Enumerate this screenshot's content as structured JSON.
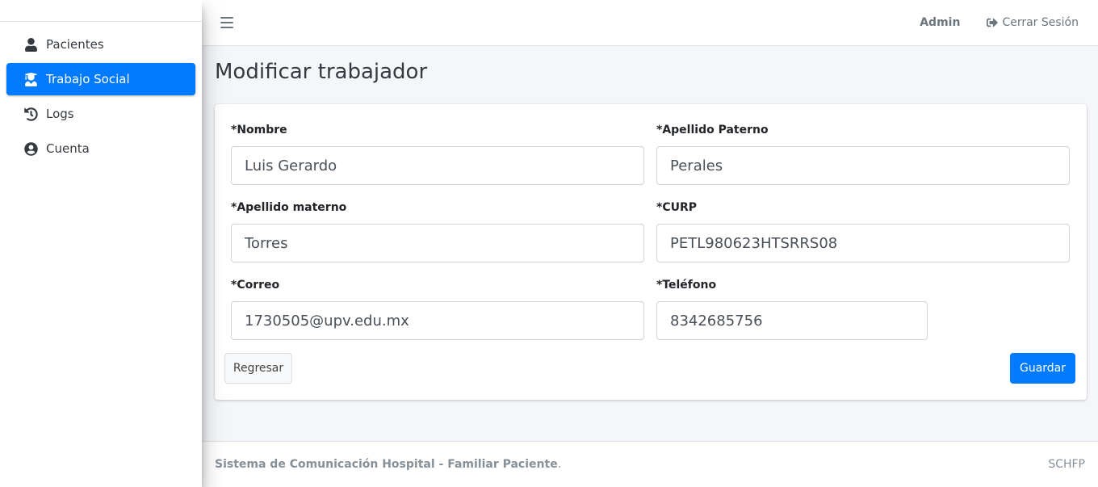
{
  "sidebar": {
    "items": [
      {
        "label": "Pacientes",
        "icon": "user-icon",
        "active": false
      },
      {
        "label": "Trabajo Social",
        "icon": "user-nurse-icon",
        "active": true
      },
      {
        "label": "Logs",
        "icon": "history-icon",
        "active": false
      },
      {
        "label": "Cuenta",
        "icon": "user-circle-icon",
        "active": false
      }
    ]
  },
  "header": {
    "user": "Admin",
    "logout_label": "Cerrar Sesión"
  },
  "main": {
    "title": "Modificar trabajador",
    "form": {
      "nombre": {
        "label": "*Nombre",
        "value": "Luis Gerardo"
      },
      "apellido_paterno": {
        "label": "*Apellido Paterno",
        "value": "Perales"
      },
      "apellido_materno": {
        "label": "*Apellido materno",
        "value": "Torres"
      },
      "curp": {
        "label": "*CURP",
        "value": "PETL980623HTSRRS08"
      },
      "correo": {
        "label": "*Correo",
        "value": "1730505@upv.edu.mx"
      },
      "telefono": {
        "label": "*Teléfono",
        "value": "8342685756"
      }
    },
    "back_label": "Regresar",
    "save_label": "Guardar"
  },
  "footer": {
    "system_name": "Sistema de Comunicación Hospital - Familiar Paciente",
    "period": ".",
    "brand": "SCHFP"
  },
  "colors": {
    "accent": "#007bff",
    "background": "#f4f6f9"
  }
}
